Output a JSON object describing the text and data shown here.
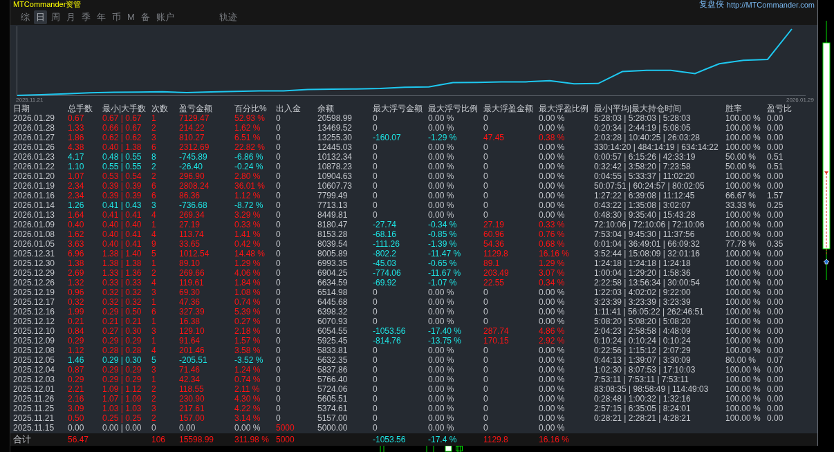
{
  "app": {
    "title": "MTCommander资管",
    "brand": "复盘侠",
    "link": "http://MTCommander.com"
  },
  "tabs": [
    {
      "label": "综",
      "selected": false
    },
    {
      "label": "日",
      "selected": true
    },
    {
      "label": "周",
      "selected": false
    },
    {
      "label": "月",
      "selected": false
    },
    {
      "label": "季",
      "selected": false
    },
    {
      "label": "年",
      "selected": false
    },
    {
      "label": "币",
      "selected": false
    },
    {
      "label": "M",
      "selected": false
    },
    {
      "label": "备",
      "selected": false
    },
    {
      "label": "账户",
      "selected": false
    },
    {
      "label": "轨迹",
      "selected": false
    }
  ],
  "chart": {
    "start_label": "2025.11.21",
    "end_label": "2026.01.29"
  },
  "table": {
    "columns": [
      "日期",
      "总手数",
      "最小|大手数",
      "次数",
      "盈亏金额",
      "百分比%",
      "出入金",
      "余额",
      "最大浮亏金额",
      "最大浮亏比例",
      "最大浮盈金额",
      "最大浮盈比例",
      "最小|平均|最大持仓时间",
      "胜率",
      "盈亏比"
    ],
    "rows": [
      {
        "gain": true,
        "loss": false,
        "deposit": false,
        "float_loss": false,
        "float_profit": false,
        "cells": [
          "2026.01.29",
          "0.67",
          "0.67 | 0.67",
          "1",
          "7129.47",
          "52.93 %",
          "0",
          "20598.99",
          "0",
          "0.00 %",
          "0",
          "0.00 %",
          "5:28:03 | 5:28:03 | 5:28:03",
          "100.00 %",
          "0.00"
        ]
      },
      {
        "gain": true,
        "loss": false,
        "deposit": false,
        "float_loss": false,
        "float_profit": false,
        "cells": [
          "2026.01.28",
          "1.33",
          "0.66 | 0.67",
          "2",
          "214.22",
          "1.62 %",
          "0",
          "13469.52",
          "0",
          "0.00 %",
          "0",
          "0.00 %",
          "0:20:34 | 2:44:19 | 5:08:05",
          "100.00 %",
          "0.00"
        ]
      },
      {
        "gain": true,
        "loss": false,
        "deposit": false,
        "float_loss": true,
        "float_profit": true,
        "cells": [
          "2026.01.27",
          "1.86",
          "0.62 | 0.62",
          "3",
          "810.27",
          "6.51 %",
          "0",
          "13255.30",
          "-160.07",
          "-1.29 %",
          "47.45",
          "0.38 %",
          "2:03:28 | 10:40:25 | 26:03:28",
          "100.00 %",
          "0.00"
        ]
      },
      {
        "gain": true,
        "loss": false,
        "deposit": false,
        "float_loss": false,
        "float_profit": false,
        "cells": [
          "2026.01.26",
          "4.38",
          "0.40 | 1.38",
          "6",
          "2312.69",
          "22.82 %",
          "0",
          "12445.03",
          "0",
          "0.00 %",
          "0",
          "0.00 %",
          "330:14:20 | 484:14:19 | 634:14:22",
          "100.00 %",
          "0.00"
        ]
      },
      {
        "gain": false,
        "loss": true,
        "deposit": false,
        "float_loss": false,
        "float_profit": false,
        "cells": [
          "2026.01.23",
          "4.17",
          "0.48 | 0.55",
          "8",
          "-745.89",
          "-6.86 %",
          "0",
          "10132.34",
          "0",
          "0.00 %",
          "0",
          "0.00 %",
          "0:00:57 | 6:15:26 | 42:33:19",
          "50.00 %",
          "0.51"
        ]
      },
      {
        "gain": false,
        "loss": true,
        "deposit": false,
        "float_loss": false,
        "float_profit": false,
        "cells": [
          "2026.01.22",
          "1.10",
          "0.55 | 0.55",
          "2",
          "-26.40",
          "-0.24 %",
          "0",
          "10878.23",
          "0",
          "0.00 %",
          "0",
          "0.00 %",
          "0:32:42 | 3:58:20 | 7:23:58",
          "50.00 %",
          "0.51"
        ]
      },
      {
        "gain": true,
        "loss": false,
        "deposit": false,
        "float_loss": false,
        "float_profit": false,
        "cells": [
          "2026.01.20",
          "1.07",
          "0.53 | 0.54",
          "2",
          "296.90",
          "2.80 %",
          "0",
          "10904.63",
          "0",
          "0.00 %",
          "0",
          "0.00 %",
          "0:04:55 | 5:33:37 | 11:02:20",
          "100.00 %",
          "0.00"
        ]
      },
      {
        "gain": true,
        "loss": false,
        "deposit": false,
        "float_loss": false,
        "float_profit": false,
        "cells": [
          "2026.01.19",
          "2.34",
          "0.39 | 0.39",
          "6",
          "2808.24",
          "36.01 %",
          "0",
          "10607.73",
          "0",
          "0.00 %",
          "0",
          "0.00 %",
          "50:07:51 | 60:24:57 | 80:02:05",
          "100.00 %",
          "0.00"
        ]
      },
      {
        "gain": true,
        "loss": false,
        "deposit": false,
        "float_loss": false,
        "float_profit": false,
        "cells": [
          "2026.01.16",
          "2.34",
          "0.39 | 0.39",
          "6",
          "86.36",
          "1.12 %",
          "0",
          "7799.49",
          "0",
          "0.00 %",
          "0",
          "0.00 %",
          "1:27:22 | 6:39:08 | 11:12:45",
          "66.67 %",
          "1.57"
        ]
      },
      {
        "gain": false,
        "loss": true,
        "deposit": false,
        "float_loss": false,
        "float_profit": false,
        "cells": [
          "2026.01.14",
          "1.26",
          "0.41 | 0.43",
          "3",
          "-736.68",
          "-8.72 %",
          "0",
          "7713.13",
          "0",
          "0.00 %",
          "0",
          "0.00 %",
          "0:43:22 | 1:35:08 | 3:02:07",
          "33.33 %",
          "0.25"
        ]
      },
      {
        "gain": true,
        "loss": false,
        "deposit": false,
        "float_loss": false,
        "float_profit": false,
        "cells": [
          "2026.01.13",
          "1.64",
          "0.41 | 0.41",
          "4",
          "269.34",
          "3.29 %",
          "0",
          "8449.81",
          "0",
          "0.00 %",
          "0",
          "0.00 %",
          "0:48:30 | 9:35:40 | 15:43:28",
          "100.00 %",
          "0.00"
        ]
      },
      {
        "gain": true,
        "loss": false,
        "deposit": false,
        "float_loss": true,
        "float_profit": true,
        "cells": [
          "2026.01.09",
          "0.40",
          "0.40 | 0.40",
          "1",
          "27.19",
          "0.33 %",
          "0",
          "8180.47",
          "-27.74",
          "-0.34 %",
          "27.19",
          "0.33 %",
          "72:10:06 | 72:10:06 | 72:10:06",
          "100.00 %",
          "0.00"
        ]
      },
      {
        "gain": true,
        "loss": false,
        "deposit": false,
        "float_loss": true,
        "float_profit": true,
        "cells": [
          "2026.01.08",
          "1.62",
          "0.40 | 0.41",
          "4",
          "113.74",
          "1.41 %",
          "0",
          "8153.28",
          "-68.16",
          "-0.85 %",
          "60.96",
          "0.76 %",
          "7:53:04 | 9:45:30 | 11:37:56",
          "100.00 %",
          "0.00"
        ]
      },
      {
        "gain": true,
        "loss": false,
        "deposit": false,
        "float_loss": true,
        "float_profit": true,
        "cells": [
          "2026.01.05",
          "3.63",
          "0.40 | 0.41",
          "9",
          "33.65",
          "0.42 %",
          "0",
          "8039.54",
          "-111.26",
          "-1.39 %",
          "54.36",
          "0.68 %",
          "0:01:04 | 36:49:01 | 66:09:32",
          "77.78 %",
          "0.35"
        ]
      },
      {
        "gain": true,
        "loss": false,
        "deposit": false,
        "float_loss": true,
        "float_profit": true,
        "cells": [
          "2025.12.31",
          "6.96",
          "1.38 | 1.40",
          "5",
          "1012.54",
          "14.48 %",
          "0",
          "8005.89",
          "-802.2",
          "-11.47 %",
          "1129.8",
          "16.16 %",
          "3:52:44 | 15:08:09 | 32:01:16",
          "100.00 %",
          "0.00"
        ]
      },
      {
        "gain": true,
        "loss": false,
        "deposit": false,
        "float_loss": true,
        "float_profit": true,
        "cells": [
          "2025.12.30",
          "1.38",
          "1.38 | 1.38",
          "1",
          "89.10",
          "1.29 %",
          "0",
          "6993.35",
          "-45.03",
          "-0.65 %",
          "89.1",
          "1.29 %",
          "1:24:18 | 1:24:18 | 1:24:18",
          "100.00 %",
          "0.00"
        ]
      },
      {
        "gain": true,
        "loss": false,
        "deposit": false,
        "float_loss": true,
        "float_profit": true,
        "cells": [
          "2025.12.29",
          "2.69",
          "1.33 | 1.36",
          "2",
          "269.66",
          "4.06 %",
          "0",
          "6904.25",
          "-774.06",
          "-11.67 %",
          "203.49",
          "3.07 %",
          "1:00:04 | 1:29:20 | 1:58:36",
          "100.00 %",
          "0.00"
        ]
      },
      {
        "gain": true,
        "loss": false,
        "deposit": false,
        "float_loss": true,
        "float_profit": true,
        "cells": [
          "2025.12.26",
          "1.32",
          "0.33 | 0.33",
          "4",
          "119.61",
          "1.84 %",
          "0",
          "6634.59",
          "-69.92",
          "-1.07 %",
          "22.55",
          "0.34 %",
          "2:22:58 | 13:56:34 | 30:00:54",
          "100.00 %",
          "0.00"
        ]
      },
      {
        "gain": true,
        "loss": false,
        "deposit": false,
        "float_loss": false,
        "float_profit": false,
        "cells": [
          "2025.12.19",
          "0.96",
          "0.32 | 0.32",
          "3",
          "69.30",
          "1.08 %",
          "0",
          "6514.98",
          "0",
          "0.00 %",
          "0",
          "0.00 %",
          "1:22:03 | 4:02:02 | 9:22:00",
          "100.00 %",
          "0.00"
        ]
      },
      {
        "gain": true,
        "loss": false,
        "deposit": false,
        "float_loss": false,
        "float_profit": false,
        "cells": [
          "2025.12.17",
          "0.32",
          "0.32 | 0.32",
          "1",
          "47.36",
          "0.74 %",
          "0",
          "6445.68",
          "0",
          "0.00 %",
          "0",
          "0.00 %",
          "3:23:39 | 3:23:39 | 3:23:39",
          "100.00 %",
          "0.00"
        ]
      },
      {
        "gain": true,
        "loss": false,
        "deposit": false,
        "float_loss": false,
        "float_profit": false,
        "cells": [
          "2025.12.16",
          "1.99",
          "0.29 | 0.50",
          "6",
          "327.39",
          "5.39 %",
          "0",
          "6398.32",
          "0",
          "0.00 %",
          "0",
          "0.00 %",
          "1:11:41 | 56:05:22 | 262:46:51",
          "100.00 %",
          "0.00"
        ]
      },
      {
        "gain": true,
        "loss": false,
        "deposit": false,
        "float_loss": false,
        "float_profit": false,
        "cells": [
          "2025.12.12",
          "0.21",
          "0.21 | 0.21",
          "1",
          "16.38",
          "0.27 %",
          "0",
          "6070.93",
          "0",
          "0.00 %",
          "0",
          "0.00 %",
          "5:08:20 | 5:08:20 | 5:08:20",
          "100.00 %",
          "0.00"
        ]
      },
      {
        "gain": true,
        "loss": false,
        "deposit": false,
        "float_loss": true,
        "float_profit": true,
        "cells": [
          "2025.12.10",
          "0.84",
          "0.27 | 0.30",
          "3",
          "129.10",
          "2.18 %",
          "0",
          "6054.55",
          "-1053.56",
          "-17.40 %",
          "287.74",
          "4.86 %",
          "2:04:23 | 2:58:58 | 4:48:09",
          "100.00 %",
          "0.00"
        ]
      },
      {
        "gain": true,
        "loss": false,
        "deposit": false,
        "float_loss": true,
        "float_profit": true,
        "cells": [
          "2025.12.09",
          "0.29",
          "0.29 | 0.29",
          "1",
          "91.64",
          "1.57 %",
          "0",
          "5925.45",
          "-814.76",
          "-13.75 %",
          "170.15",
          "2.92 %",
          "0:10:24 | 0:10:24 | 0:10:24",
          "100.00 %",
          "0.00"
        ]
      },
      {
        "gain": true,
        "loss": false,
        "deposit": false,
        "float_loss": false,
        "float_profit": false,
        "cells": [
          "2025.12.08",
          "1.12",
          "0.28 | 0.28",
          "4",
          "201.46",
          "3.58 %",
          "0",
          "5833.81",
          "0",
          "0.00 %",
          "0",
          "0.00 %",
          "0:22:56 | 1:15:12 | 2:07:29",
          "100.00 %",
          "0.00"
        ]
      },
      {
        "gain": false,
        "loss": true,
        "deposit": false,
        "float_loss": false,
        "float_profit": false,
        "cells": [
          "2025.12.05",
          "1.46",
          "0.29 | 0.30",
          "5",
          "-205.51",
          "-3.52 %",
          "0",
          "5632.35",
          "0",
          "0.00 %",
          "0",
          "0.00 %",
          "0:44:13 | 1:39:07 | 3:30:09",
          "80.00 %",
          "0.07"
        ]
      },
      {
        "gain": true,
        "loss": false,
        "deposit": false,
        "float_loss": false,
        "float_profit": false,
        "cells": [
          "2025.12.04",
          "0.87",
          "0.29 | 0.29",
          "3",
          "71.46",
          "1.24 %",
          "0",
          "5837.86",
          "0",
          "0.00 %",
          "0",
          "0.00 %",
          "1:02:30 | 8:07:53 | 17:10:03",
          "100.00 %",
          "0.00"
        ]
      },
      {
        "gain": true,
        "loss": false,
        "deposit": false,
        "float_loss": false,
        "float_profit": false,
        "cells": [
          "2025.12.03",
          "0.29",
          "0.29 | 0.29",
          "1",
          "42.34",
          "0.74 %",
          "0",
          "5766.40",
          "0",
          "0.00 %",
          "0",
          "0.00 %",
          "7:53:11 | 7:53:11 | 7:53:11",
          "100.00 %",
          "0.00"
        ]
      },
      {
        "gain": true,
        "loss": false,
        "deposit": false,
        "float_loss": false,
        "float_profit": false,
        "cells": [
          "2025.12.01",
          "2.21",
          "1.09 | 1.12",
          "2",
          "118.55",
          "2.11 %",
          "0",
          "5724.06",
          "0",
          "0.00 %",
          "0",
          "0.00 %",
          "83:08:35 | 98:58:49 | 114:49:03",
          "100.00 %",
          "0.00"
        ]
      },
      {
        "gain": true,
        "loss": false,
        "deposit": false,
        "float_loss": false,
        "float_profit": false,
        "cells": [
          "2025.11.26",
          "2.16",
          "1.07 | 1.09",
          "2",
          "230.90",
          "4.30 %",
          "0",
          "5605.51",
          "0",
          "0.00 %",
          "0",
          "0.00 %",
          "0:28:48 | 1:00:32 | 1:32:16",
          "100.00 %",
          "0.00"
        ]
      },
      {
        "gain": true,
        "loss": false,
        "deposit": false,
        "float_loss": false,
        "float_profit": false,
        "cells": [
          "2025.11.25",
          "3.09",
          "1.03 | 1.03",
          "3",
          "217.61",
          "4.22 %",
          "0",
          "5374.61",
          "0",
          "0.00 %",
          "0",
          "0.00 %",
          "2:57:15 | 6:35:05 | 8:24:01",
          "100.00 %",
          "0.00"
        ]
      },
      {
        "gain": true,
        "loss": false,
        "deposit": false,
        "float_loss": false,
        "float_profit": false,
        "cells": [
          "2025.11.21",
          "0.50",
          "0.25 | 0.25",
          "2",
          "157.00",
          "3.14 %",
          "0",
          "5157.00",
          "0",
          "0.00 %",
          "0",
          "0.00 %",
          "0:28:21 | 2:28:21 | 4:28:21",
          "100.00 %",
          "0.00"
        ]
      },
      {
        "gain": false,
        "loss": false,
        "deposit": true,
        "float_loss": false,
        "float_profit": false,
        "cells": [
          "2025.11.15",
          "0.00",
          "0.00 | 0.00",
          "0",
          "0.00",
          "0.00 %",
          "5000",
          "5000.00",
          "0",
          "0.00 %",
          "0",
          "0.00 %"
        ]
      }
    ],
    "totals": {
      "label": "合计",
      "total_lots": "56.47",
      "trades": "106",
      "pnl": "15598.99",
      "pct": "311.98 %",
      "deposit": "5000",
      "max_float_loss": "-1053.56",
      "max_float_loss_pct": "-17.4 %",
      "max_float_profit": "1129.8",
      "max_float_profit_pct": "16.16 %"
    }
  }
}
